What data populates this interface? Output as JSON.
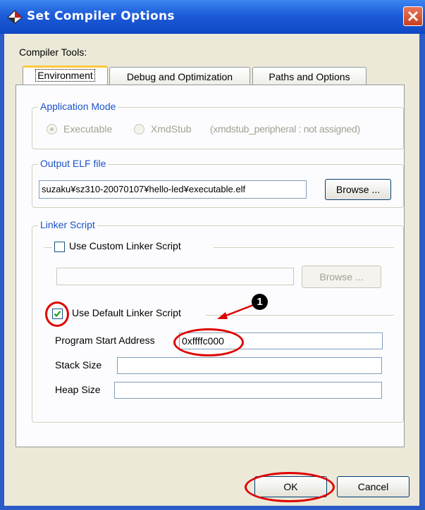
{
  "window": {
    "title": "Set Compiler Options"
  },
  "compiler_tools_label": "Compiler Tools:",
  "tabs": [
    {
      "label": "Environment"
    },
    {
      "label": "Debug and Optimization"
    },
    {
      "label": "Paths and Options"
    }
  ],
  "application_mode": {
    "legend": "Application Mode",
    "executable_label": "Executable",
    "xmdstub_label": "XmdStub",
    "xmdstub_note": "(xmdstub_peripheral : not assigned)"
  },
  "output_elf": {
    "legend": "Output ELF file",
    "path": "suzaku¥sz310-20070107¥hello-led¥executable.elf",
    "browse_label": "Browse ..."
  },
  "linker_script": {
    "legend": "Linker Script",
    "custom_label": "Use Custom Linker Script",
    "custom_path": "",
    "custom_browse_label": "Browse ...",
    "default_label": "Use Default Linker Script",
    "default_checked": true,
    "program_start_label": "Program Start Address",
    "program_start_value": "0xffffc000",
    "stack_size_label": "Stack Size",
    "stack_size_value": "",
    "heap_size_label": "Heap Size",
    "heap_size_value": ""
  },
  "annotation": {
    "marker": "1"
  },
  "buttons": {
    "ok_label": "OK",
    "cancel_label": "Cancel"
  },
  "colors": {
    "titlebar": "#0f47c2",
    "annotation_red": "#e00000",
    "group_label_blue": "#1a52c8"
  }
}
